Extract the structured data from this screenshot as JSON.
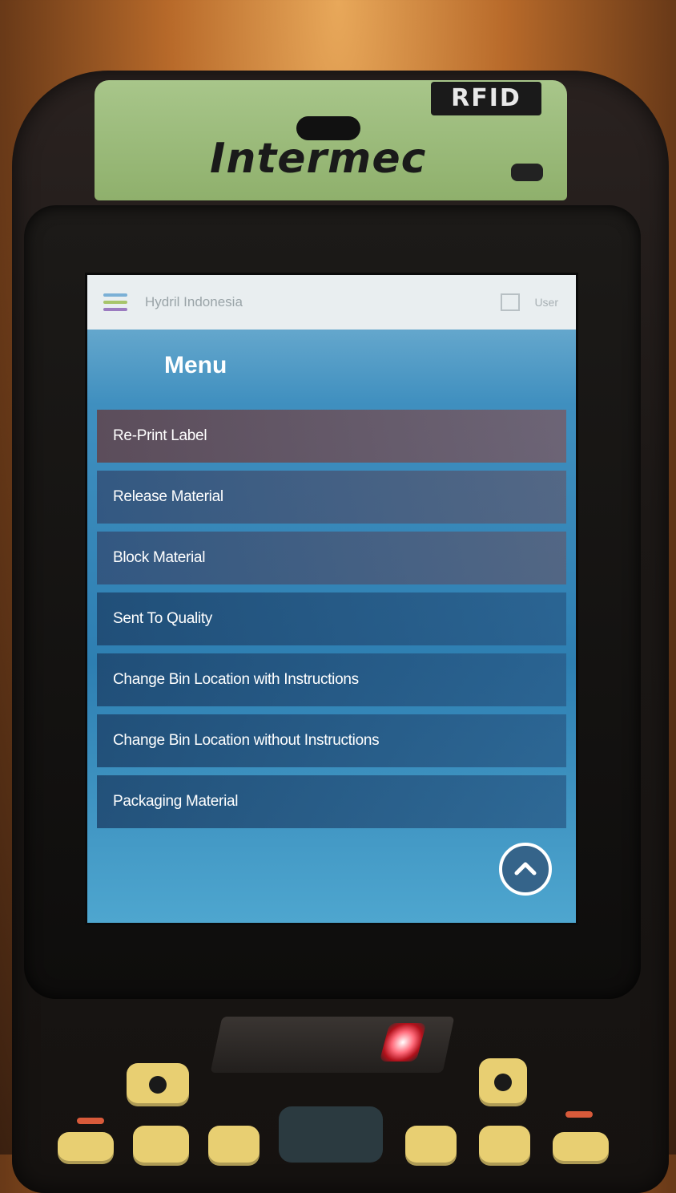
{
  "device": {
    "brand": "Intermec",
    "rfid_label": "RFID"
  },
  "app": {
    "company": "Hydril Indonesia",
    "user_label": "User",
    "menu_title": "Menu",
    "menu_items": [
      {
        "label": "Re-Print Label"
      },
      {
        "label": "Release Material"
      },
      {
        "label": "Block Material"
      },
      {
        "label": "Sent To Quality"
      },
      {
        "label": "Change Bin Location with Instructions"
      },
      {
        "label": "Change Bin Location without Instructions"
      },
      {
        "label": "Packaging Material"
      }
    ],
    "icons": {
      "menu": "hamburger-icon",
      "scroll_top": "chevron-up-icon"
    },
    "colors": {
      "hamburger_lines": [
        "#7bb0d6",
        "#a7c56b",
        "#9b7bc0"
      ],
      "screen_accent": "#2e7fb2"
    }
  }
}
